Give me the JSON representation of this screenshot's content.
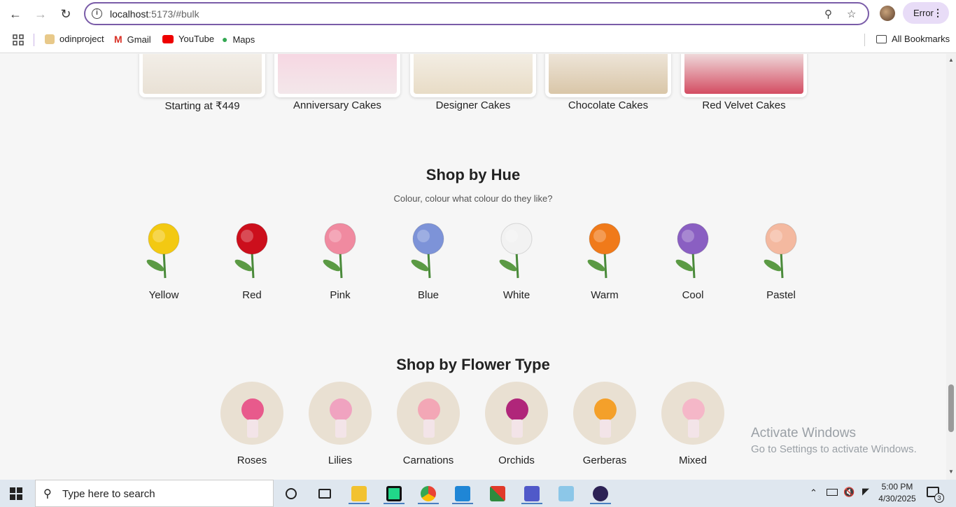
{
  "browser": {
    "url_host": "localhost",
    "url_rest": ":5173/#bulk",
    "profile_label": "Error"
  },
  "bookmarks": [
    {
      "label": "odinproject",
      "icon": "odinproject-icon"
    },
    {
      "label": "Gmail",
      "icon": "gmail-icon"
    },
    {
      "label": "YouTube",
      "icon": "youtube-icon"
    },
    {
      "label": "Maps",
      "icon": "maps-icon"
    }
  ],
  "all_bookmarks_label": "All Bookmarks",
  "cakes": [
    {
      "label": "Starting at ₹449"
    },
    {
      "label": "Anniversary Cakes"
    },
    {
      "label": "Designer Cakes"
    },
    {
      "label": "Chocolate Cakes"
    },
    {
      "label": "Red Velvet Cakes"
    }
  ],
  "hue_section": {
    "title": "Shop by Hue",
    "subtitle": "Colour, colour what colour do they like?",
    "items": [
      {
        "label": "Yellow",
        "color": "#f3c912"
      },
      {
        "label": "Red",
        "color": "#cc0f1c"
      },
      {
        "label": "Pink",
        "color": "#f08aa0"
      },
      {
        "label": "Blue",
        "color": "#7d93d8"
      },
      {
        "label": "White",
        "color": "#f2f2f2"
      },
      {
        "label": "Warm",
        "color": "#f07a1a"
      },
      {
        "label": "Cool",
        "color": "#8a5fc2"
      },
      {
        "label": "Pastel",
        "color": "#f4b9a0"
      }
    ]
  },
  "flower_type_section": {
    "title": "Shop by Flower Type",
    "items": [
      {
        "label": "Roses"
      },
      {
        "label": "Lilies"
      },
      {
        "label": "Carnations"
      },
      {
        "label": "Orchids"
      },
      {
        "label": "Gerberas"
      },
      {
        "label": "Mixed"
      }
    ]
  },
  "watermark": {
    "line1": "Activate Windows",
    "line2": "Go to Settings to activate Windows."
  },
  "taskbar": {
    "search_placeholder": "Type here to search",
    "time": "5:00 PM",
    "date": "4/30/2025",
    "notification_count": "3"
  }
}
